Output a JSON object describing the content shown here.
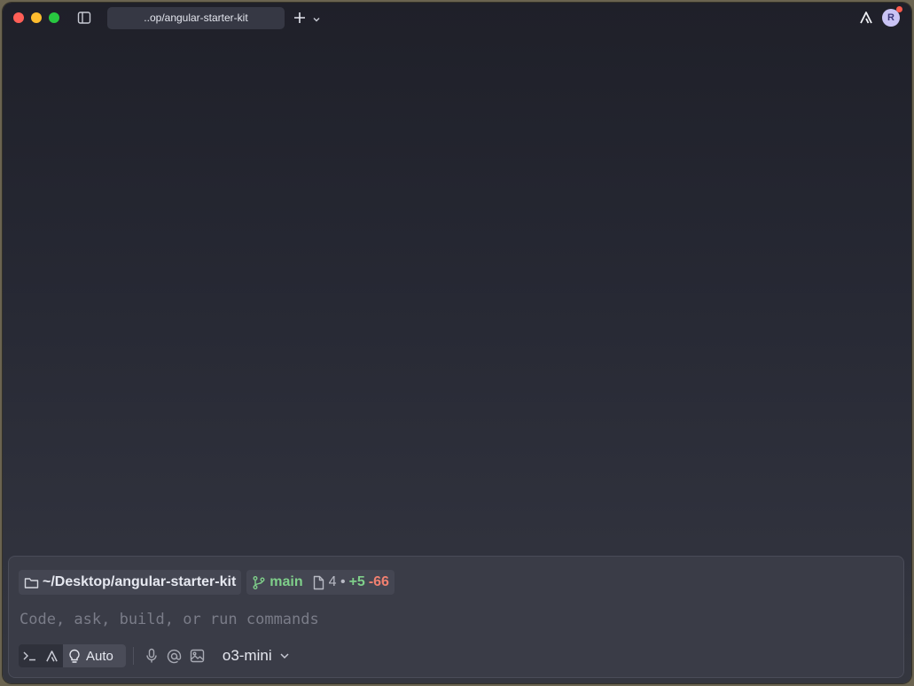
{
  "window": {
    "tab_title": "..op/angular-starter-kit",
    "avatar_initial": "R"
  },
  "context": {
    "path": "~/Desktop/angular-starter-kit",
    "branch": "main",
    "files_changed": "4 •",
    "additions": "+5",
    "deletions": "-66"
  },
  "input": {
    "placeholder": "Code, ask, build, or run commands",
    "value": ""
  },
  "toolbar": {
    "mode_label": "Auto",
    "model": "o3-mini"
  },
  "colors": {
    "branch_green": "#7fcf8a",
    "deletion_red": "#f08070",
    "avatar_bg": "#c9c3f4",
    "notification_dot": "#ff5a4d"
  }
}
